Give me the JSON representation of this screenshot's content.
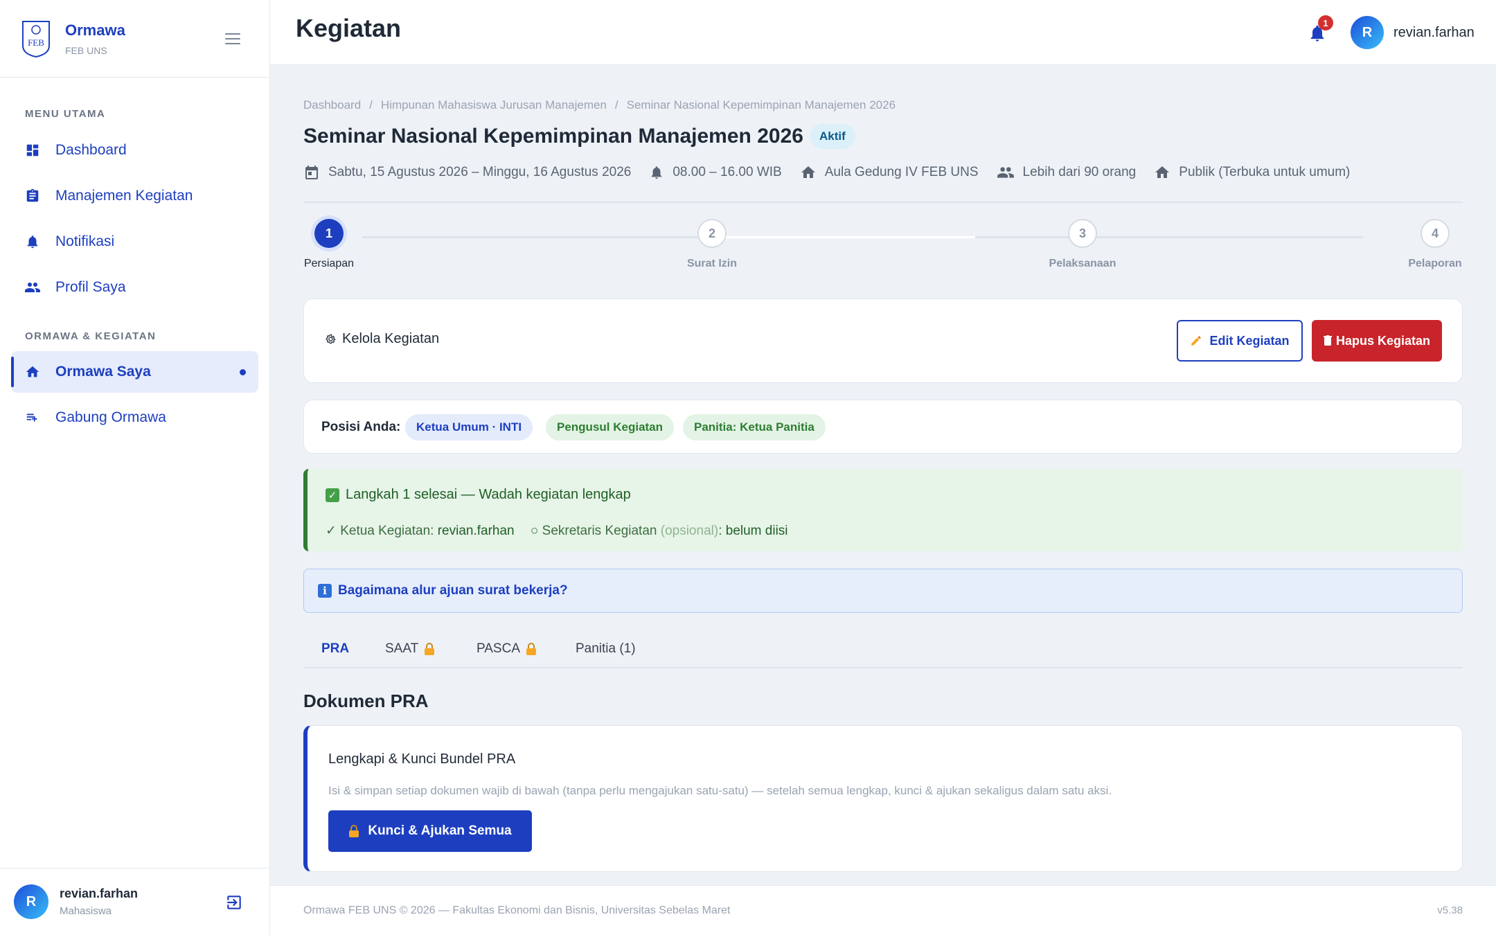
{
  "brand": {
    "name": "Ormawa",
    "sub": "FEB UNS",
    "logo_text": "FEB"
  },
  "sidebar": {
    "section1": "MENU UTAMA",
    "section2": "ORMAWA & KEGIATAN",
    "items": [
      {
        "label": "Dashboard",
        "icon": "dashboard-icon"
      },
      {
        "label": "Manajemen Kegiatan",
        "icon": "clipboard-icon"
      },
      {
        "label": "Notifikasi",
        "icon": "bell-icon"
      },
      {
        "label": "Profil Saya",
        "icon": "people-icon"
      },
      {
        "label": "Ormawa Saya",
        "icon": "home-icon",
        "active": true
      },
      {
        "label": "Gabung Ormawa",
        "icon": "playlist-add-icon"
      }
    ],
    "user": {
      "initial": "R",
      "name": "revian.farhan",
      "role": "Mahasiswa"
    }
  },
  "topbar": {
    "title": "Kegiatan",
    "notif_count": "1",
    "user": {
      "initial": "R",
      "name": "revian.farhan"
    }
  },
  "breadcrumb": [
    "Dashboard",
    "Himpunan Mahasiswa Jurusan Manajemen",
    "Seminar Nasional Kepemimpinan Manajemen 2026"
  ],
  "event": {
    "title": "Seminar Nasional Kepemimpinan Manajemen 2026",
    "status": "Aktif",
    "date": "Sabtu, 15 Agustus 2026 – Minggu, 16 Agustus 2026",
    "time": "08.00 – 16.00 WIB",
    "location": "Aula Gedung IV FEB UNS",
    "participants": "Lebih dari 90 orang",
    "visibility": "Publik (Terbuka untuk umum)"
  },
  "stepper": [
    {
      "num": "1",
      "label": "Persiapan",
      "active": true
    },
    {
      "num": "2",
      "label": "Surat Izin"
    },
    {
      "num": "3",
      "label": "Pelaksanaan"
    },
    {
      "num": "4",
      "label": "Pelaporan"
    }
  ],
  "manage": {
    "icon": "gear-icon",
    "label": "Kelola Kegiatan",
    "edit_label": "Edit Kegiatan",
    "delete_label": "Hapus Kegiatan"
  },
  "position": {
    "label": "Posisi Anda:",
    "chips": [
      "Ketua Umum · INTI",
      "Pengusul Kegiatan",
      "Panitia: Ketua Panitia"
    ]
  },
  "success": {
    "title": "Langkah 1 selesai — Wadah kegiatan lengkap",
    "ketua_label": "✓ Ketua Kegiatan:",
    "ketua_value": "revian.farhan",
    "sekretaris_label": "○ Sekretaris Kegiatan",
    "sekretaris_opt": "(opsional)",
    "sekretaris_value": "belum diisi"
  },
  "info": {
    "text": "Bagaimana alur ajuan surat bekerja?"
  },
  "tabs": [
    {
      "label": "PRA",
      "active": true
    },
    {
      "label": "SAAT",
      "locked": true
    },
    {
      "label": "PASCA",
      "locked": true
    },
    {
      "label": "Panitia (1)"
    }
  ],
  "section_title": "Dokumen PRA",
  "pra_card": {
    "title": "Lengkapi & Kunci Bundel PRA",
    "desc": "Isi & simpan setiap dokumen wajib di bawah (tanpa perlu mengajukan satu-satu) — setelah semua lengkap, kunci & ajukan sekaligus dalam satu aksi.",
    "button": "Kunci & Ajukan Semua"
  },
  "footer": {
    "text": "Ormawa FEB UNS © 2026 — Fakultas Ekonomi dan Bisnis, Universitas Sebelas Maret",
    "version": "v5.38"
  },
  "colors": {
    "primary": "#1d3fbf",
    "danger": "#c9242b",
    "success": "#2e7d32",
    "lock": "#f5a623"
  }
}
